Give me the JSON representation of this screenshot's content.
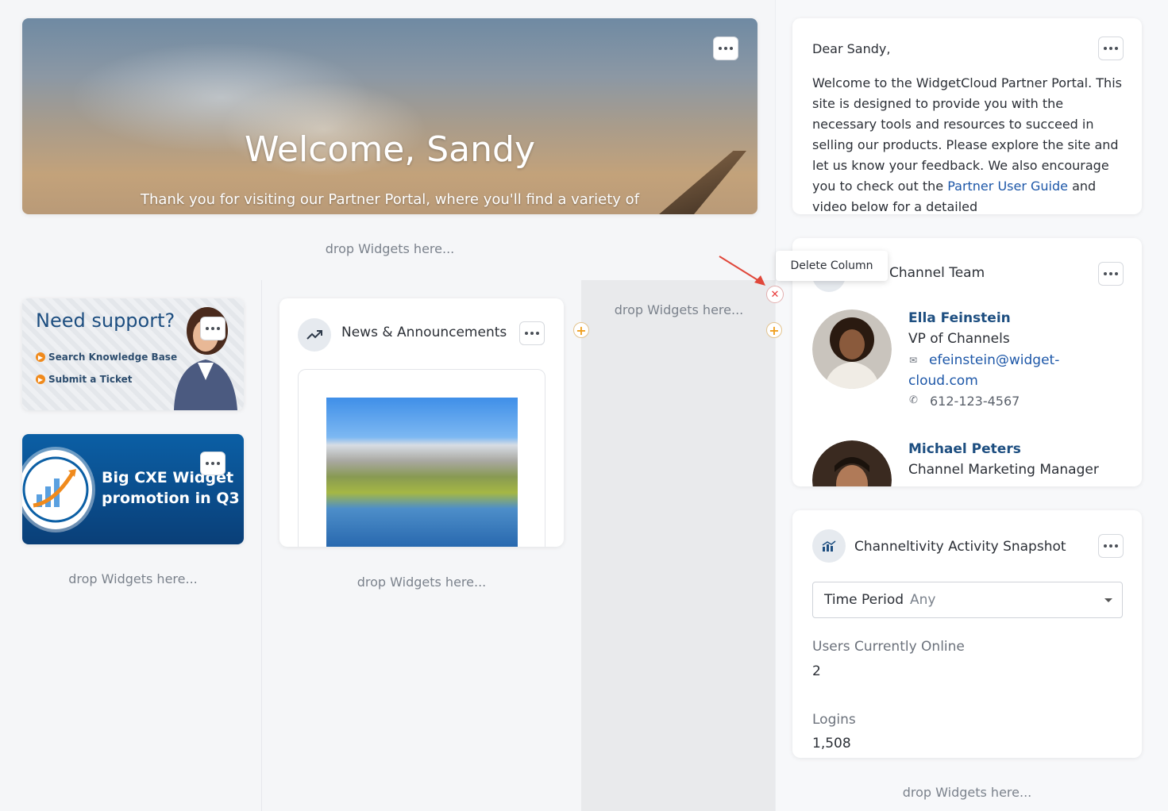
{
  "hero": {
    "title": "Welcome, Sandy",
    "subtitle": "Thank you for visiting our Partner Portal, where you'll find a variety of"
  },
  "drop_text": "drop Widgets here...",
  "support": {
    "heading": "Need support?",
    "links": [
      "Search Knowledge Base",
      "Submit a Ticket"
    ]
  },
  "promo": {
    "line1": "Big CXE Widget",
    "line2": "promotion in Q3"
  },
  "news": {
    "title": "News & Announcements"
  },
  "letter": {
    "greeting": "Dear Sandy,",
    "text_before": "Welcome to the WidgetCloud Partner Portal. This site is designed to provide you with the necessary tools and resources to succeed in selling our products. Please explore the site and let us know your feedback. We also encourage you to check out the ",
    "link": "Partner User Guide",
    "text_after": " and video below for a detailed"
  },
  "tooltip": "Delete Column",
  "team": {
    "title": "Channel Team",
    "people": [
      {
        "name": "Ella Feinstein",
        "role": "VP of Channels",
        "email": "efeinstein@widget-cloud.com",
        "phone": "612-123-4567"
      },
      {
        "name": "Michael Peters",
        "role": "Channel Marketing Manager"
      }
    ]
  },
  "snapshot": {
    "title": "Channeltivity Activity Snapshot",
    "time_period_label": "Time Period",
    "time_period_value": "Any",
    "users_label": "Users Currently Online",
    "users_value": "2",
    "logins_label": "Logins",
    "logins_value": "1,508"
  },
  "colors": {
    "accent": "#f0a020",
    "link": "#1d57a8",
    "name": "#1d4e80",
    "delete": "#e83a3a"
  }
}
